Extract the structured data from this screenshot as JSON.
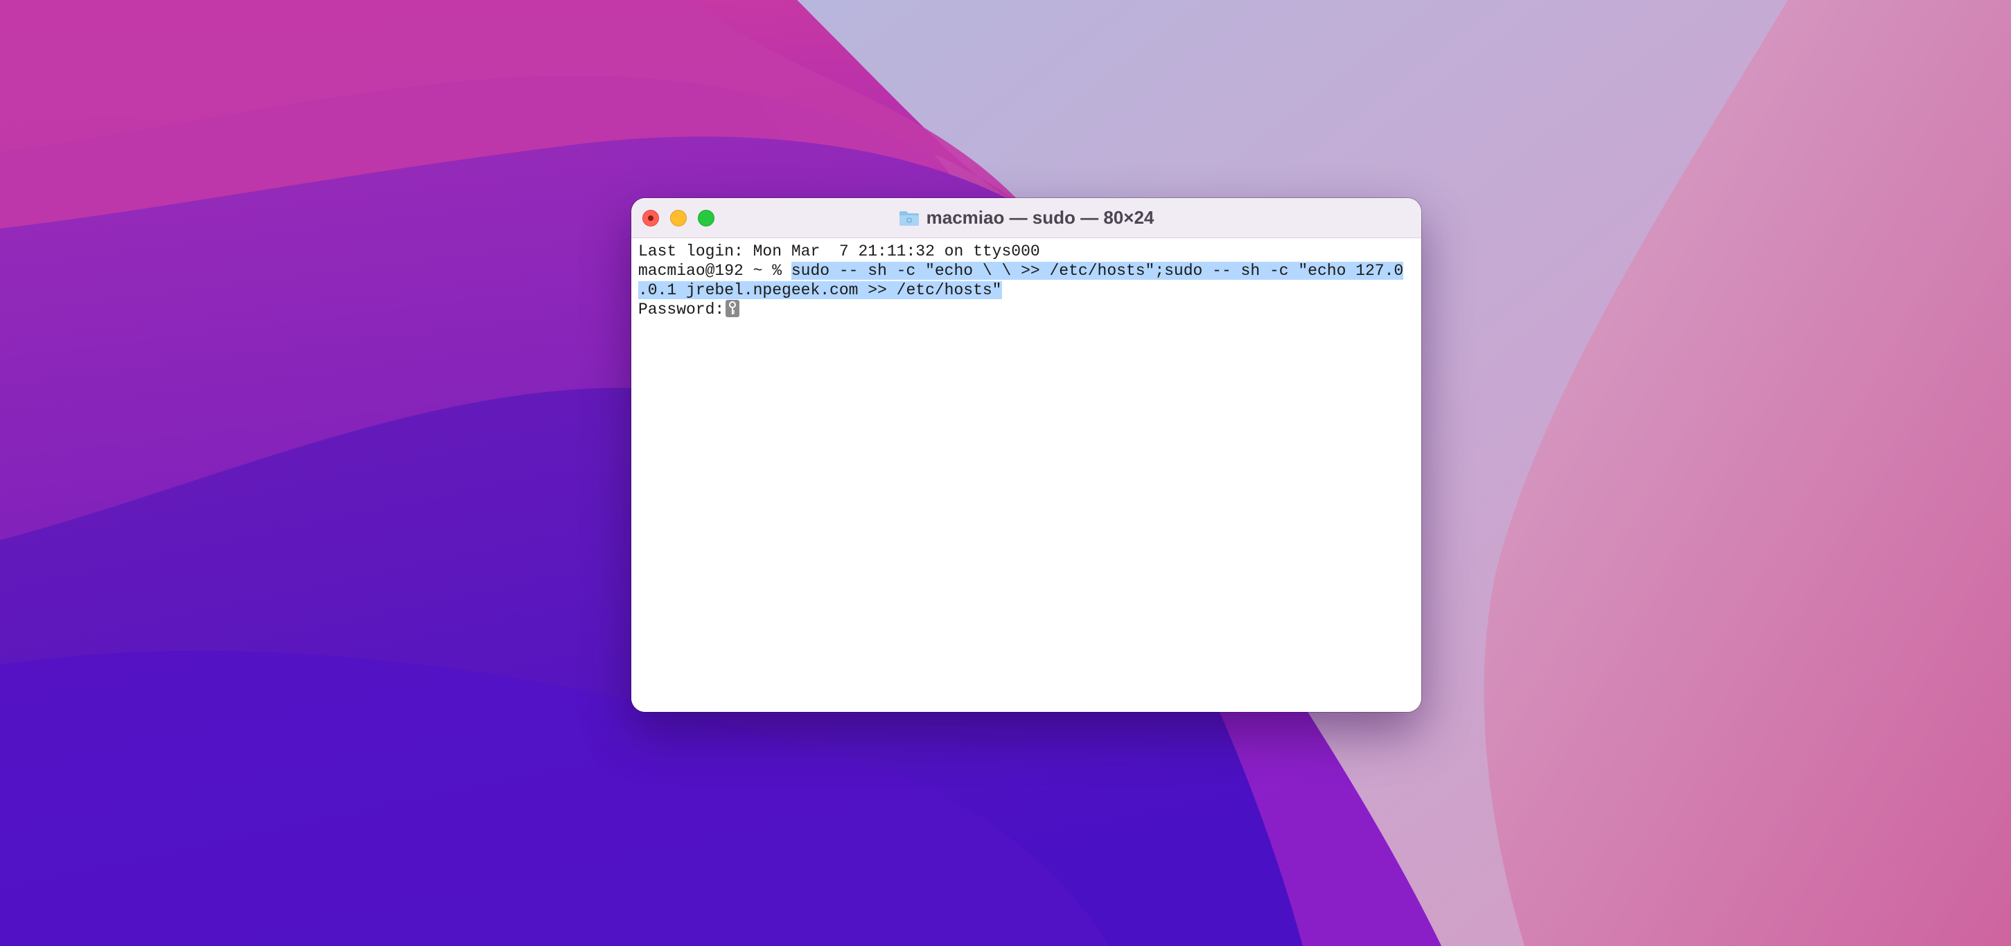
{
  "window": {
    "title": "macmiao — sudo — 80×24"
  },
  "terminal": {
    "last_login": "Last login: Mon Mar  7 21:11:32 on ttys000",
    "prompt": "macmiao@192 ~ % ",
    "command_line1": "sudo -- sh -c \"echo \\ \\ >> /etc/hosts\";sudo -- sh -c \"echo 127.0",
    "command_line2": ".0.1 jrebel.npegeek.com >> /etc/hosts\"",
    "password_prompt": "Password:"
  },
  "icons": {
    "folder": "folder-icon",
    "cursor": "key-cursor-icon",
    "close": "close-icon",
    "minimize": "minimize-icon",
    "maximize": "maximize-icon"
  },
  "colors": {
    "close": "#ff5f57",
    "minimize": "#febc2e",
    "maximize": "#28c840",
    "selection": "#b3d7ff"
  }
}
